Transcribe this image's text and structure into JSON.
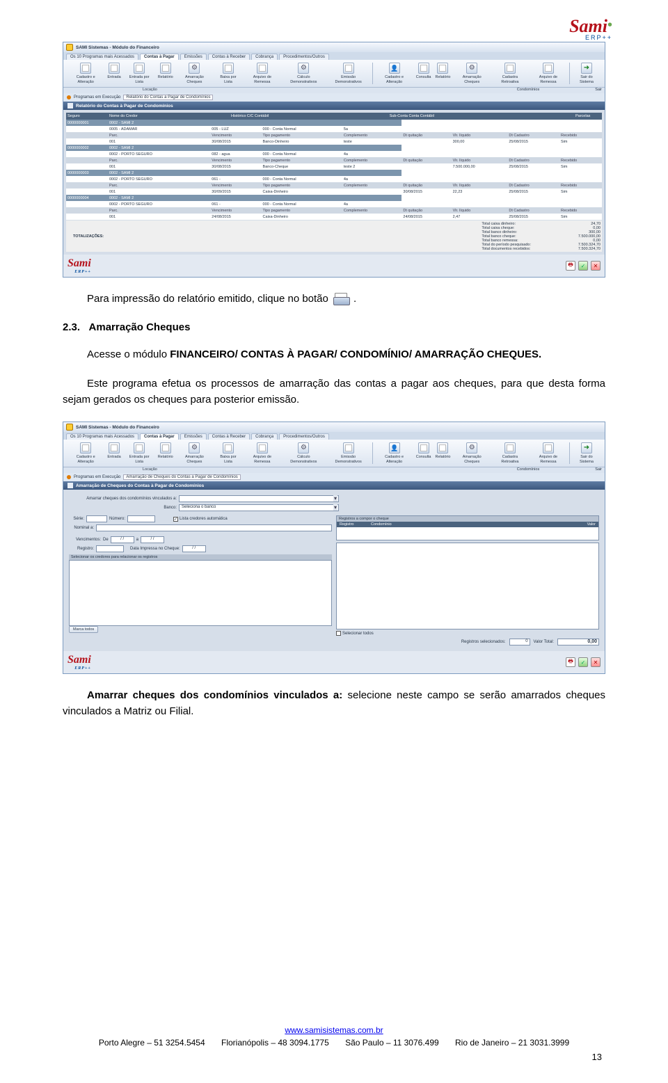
{
  "header_logo": {
    "brand": "Sami",
    "sub": "ERP++"
  },
  "win1": {
    "title": "SAMI Sistemas - Módulo do Financeiro",
    "tabs": [
      "Os 10 Programas mais Acessados",
      "Contas à Pagar",
      "Emissões",
      "Contas à Receber",
      "Cobrança",
      "Procedimentos/Outros"
    ],
    "active_tab": 1,
    "toolbar": [
      "Cadastro e Alteração",
      "Entrada",
      "Entrada por Lista",
      "Relatório",
      "Amarração Cheques",
      "Baixa por Lista",
      "Arquivo de Remessa",
      "Cálculo Demonstrativos",
      "Emissão Demonstrativos",
      "Cadastro e Alteração",
      "Consulta",
      "Relatório",
      "Amarração Cheques",
      "Cadastra Retroativa",
      "Arquivo de Remessa",
      "Sair do Sistema"
    ],
    "toolbar_caption_left": "Locação",
    "toolbar_caption_mid": "Condomínios",
    "toolbar_caption_right": "Sair",
    "crumb_label": "Programas em Execução",
    "crumb_value": "Relatório do Contas a Pagar de Condomínios",
    "panel_title": "Relatório do Contas à Pagar de Condomínios",
    "columns": [
      "Seguro",
      "Nome do Credor",
      "Histórico C/C Contábil",
      "Sub-Conta Conta Contábil",
      "Parcelas"
    ],
    "groups": [
      {
        "row_id": "0000000001",
        "code": "0002 - SAMI 2",
        "credor": "0005 - ADAMAR",
        "hist": "005 - LUZ",
        "sub": "000 - Conta Normal",
        "parc": "5a",
        "sub_headers": [
          "Parc.",
          "Vencimento",
          "Tipo pagamento",
          "Complemento",
          "Dt quitação",
          "Vlr. líquido",
          "Dt Cadastro",
          "Recebido"
        ],
        "detail": [
          "001",
          "30/08/2015",
          "Banco-Dinheiro",
          "teste",
          "",
          "300,00",
          "25/08/2015",
          "Sim"
        ]
      },
      {
        "row_id": "0000000002",
        "code": "0002 - SAMI 2",
        "credor": "0002 - PORTO SEGURO",
        "hist": "082 - agua",
        "sub": "000 - Conta Normal",
        "parc": "4a",
        "sub_headers": [
          "Parc.",
          "Vencimento",
          "Tipo pagamento",
          "Complemento",
          "Dt quitação",
          "Vlr. líquido",
          "Dt Cadastro",
          "Recebido"
        ],
        "detail": [
          "001",
          "30/08/2015",
          "Banco-Cheque",
          "teste 2",
          "",
          "7.500.000,00",
          "25/08/2015",
          "Sim"
        ]
      },
      {
        "row_id": "0000000003",
        "code": "0002 - SAMI 2",
        "credor": "0002 - PORTO SEGURO",
        "hist": "061 -",
        "sub": "000 - Conta Normal",
        "parc": "4a",
        "sub_headers": [
          "Parc.",
          "Vencimento",
          "Tipo pagamento",
          "Complemento",
          "Dt quitação",
          "Vlr. líquido",
          "Dt Cadastro",
          "Recebido"
        ],
        "detail": [
          "001",
          "30/09/2015",
          "Caixa-Dinheiro",
          "",
          "30/08/2015",
          "22,23",
          "25/08/2015",
          "Sim"
        ]
      },
      {
        "row_id": "0000000004",
        "code": "0002 - SAMI 2",
        "credor": "0002 - PORTO SEGURO",
        "hist": "061 -",
        "sub": "000 - Conta Normal",
        "parc": "4a",
        "sub_headers": [
          "Parc.",
          "Vencimento",
          "Tipo pagamento",
          "Complemento",
          "Dt quitação",
          "Vlr. líquido",
          "Dt Cadastro",
          "Recebido"
        ],
        "detail": [
          "001",
          "24/08/2015",
          "Caixa-Dinheiro",
          "",
          "24/08/2015",
          "2,47",
          "25/08/2015",
          "Sim"
        ]
      }
    ],
    "totals_label": "TOTALIZAÇÕES:",
    "totals": [
      {
        "l": "Total caixa dinheiro:",
        "v": "24,70"
      },
      {
        "l": "Total caixa cheque:",
        "v": "0,00"
      },
      {
        "l": "Total banco dinheiro:",
        "v": "300,00"
      },
      {
        "l": "Total banco cheque:",
        "v": "7.500.000,00"
      },
      {
        "l": "Total banco remessa:",
        "v": "0,00"
      },
      {
        "l": "Total do período pesquisado:",
        "v": "7.500.324,70"
      },
      {
        "l": "Total documentos recebidos:",
        "v": "7.500.324,70"
      }
    ]
  },
  "text1_prefix": "Para impressão do relatório emitido, clique no botão ",
  "text1_suffix": ".",
  "section_num": "2.3.",
  "section_title": "Amarração Cheques",
  "text2_p1a": "Acesse o módulo ",
  "text2_p1b": "FINANCEIRO/ CONTAS À PAGAR/ CONDOMÍNIO/ AMARRAÇÃO CHEQUES.",
  "text2_p2": "Este programa efetua os processos de amarração das contas a pagar aos cheques, para que desta forma sejam gerados os cheques para posterior emissão.",
  "win2": {
    "title": "SAMI Sistemas - Módulo do Financeiro",
    "crumb_value": "Amarração de Cheques do Contas a Pagar de Condomínios",
    "panel_title": "Amarração de Cheques do Contas à Pagar de Condomínios",
    "lbl_vinc": "Amarrar cheques dos condomínios vinculados a:",
    "lbl_banco": "Banco:",
    "banco_placeholder": "Seleciona o banco",
    "lbl_serie": "Série:",
    "lbl_numero": "Número:",
    "chk_auto": "Lista credores automática",
    "chk_auto_checked": true,
    "mini_head": [
      "Registros a compor o cheque"
    ],
    "mini_cols": [
      "Registro",
      "Condomínio",
      "Valor"
    ],
    "lbl_nominal": "Nominal a:",
    "lbl_venc": "Vencimentos:",
    "lbl_de": "De",
    "lbl_a": "a",
    "date_placeholder": "/ /",
    "lbl_reg": "Registro:",
    "lbl_data_imp": "Data Impressa no Cheque:",
    "lbl_sel_cred": "Selecionar os credores para relacionar os registros",
    "btn_marca": "Marca todos",
    "chk_sel_all": "Selecionar todos",
    "lbl_reg_sel": "Registros selecionados:",
    "val_reg_sel": "0",
    "lbl_val_tot": "Valor Total:",
    "val_tot": "0,00"
  },
  "text3_b": "Amarrar cheques dos condomínios vinculados a: ",
  "text3_n": "selecione neste campo se serão amarrados cheques vinculados a Matriz ou Filial.",
  "footer": {
    "url": "www.samisistemas.com.br",
    "cities": [
      "Porto Alegre – 51 3254.5454",
      "Florianópolis – 48 3094.1775",
      "São Paulo – 11 3076.499",
      "Rio de Janeiro – 21 3031.3999"
    ],
    "page": "13"
  }
}
